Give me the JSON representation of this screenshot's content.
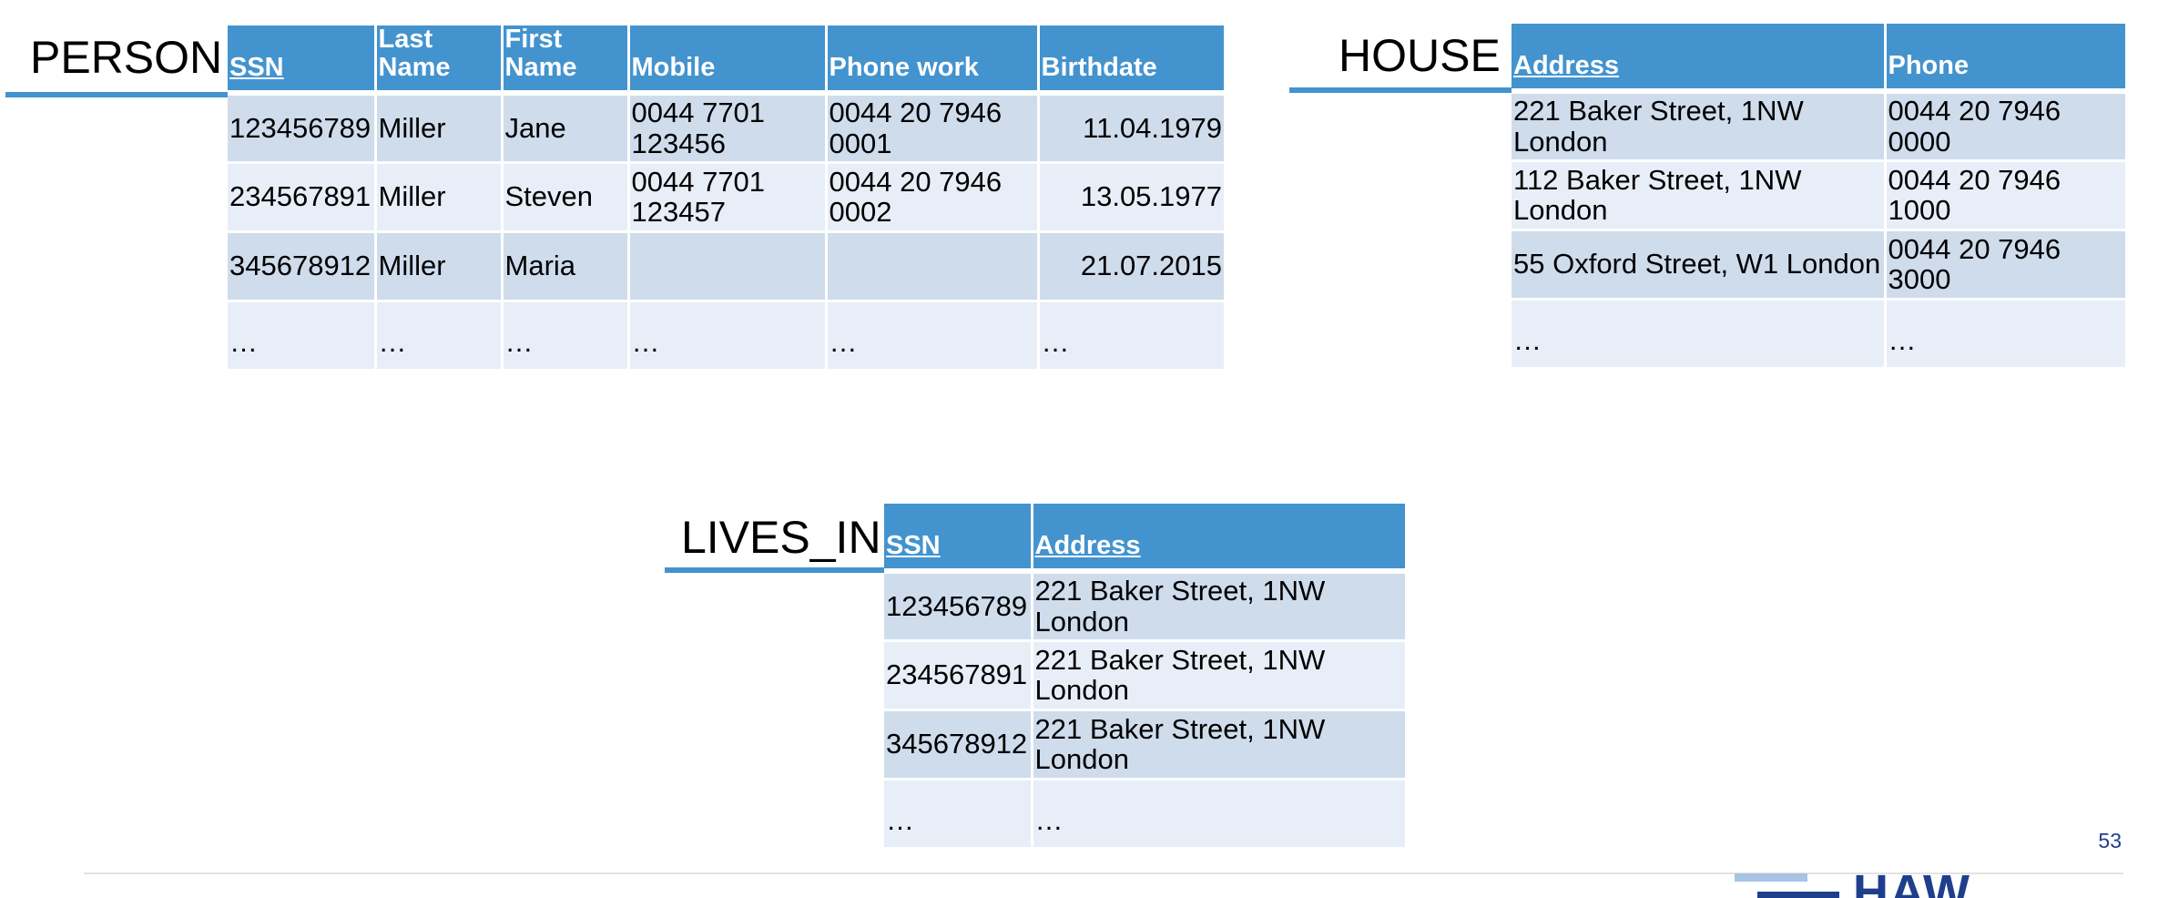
{
  "person": {
    "title": "PERSON",
    "headers": [
      "SSN",
      "Last Name",
      "First Name",
      "Mobile",
      "Phone work",
      "Birthdate"
    ],
    "rows": [
      [
        "123456789",
        "Miller",
        "Jane",
        "0044 7701 123456",
        "0044 20  7946 0001",
        "11.04.1979"
      ],
      [
        "234567891",
        "Miller",
        "Steven",
        "0044 7701 123457",
        "0044 20  7946 0002",
        "13.05.1977"
      ],
      [
        "345678912",
        "Miller",
        "Maria",
        "",
        "",
        "21.07.2015"
      ],
      [
        "…",
        "…",
        "…",
        "…",
        "…",
        "…"
      ]
    ]
  },
  "house": {
    "title": "HOUSE",
    "headers": [
      "Address",
      "Phone"
    ],
    "rows": [
      [
        "221 Baker Street, 1NW London",
        "0044 20  7946 0000"
      ],
      [
        "112 Baker Street, 1NW London",
        "0044 20  7946 1000"
      ],
      [
        "55 Oxford Street, W1 London",
        "0044 20  7946 3000"
      ],
      [
        "…",
        "…"
      ]
    ]
  },
  "lives_in": {
    "title": "LIVES_IN",
    "headers": [
      "SSN",
      "Address"
    ],
    "rows": [
      [
        "123456789",
        "221 Baker Street, 1NW London"
      ],
      [
        "234567891",
        "221 Baker Street, 1NW London"
      ],
      [
        "345678912",
        "221 Baker Street, 1NW London"
      ],
      [
        "…",
        "…"
      ]
    ]
  },
  "footer": {
    "page_number": "53",
    "logo_text": "HAW"
  },
  "colors": {
    "header_blue": "#4393cf",
    "row_dark": "#cfdcec",
    "row_light": "#e8eef7",
    "brand_navy": "#1f3f8c"
  }
}
